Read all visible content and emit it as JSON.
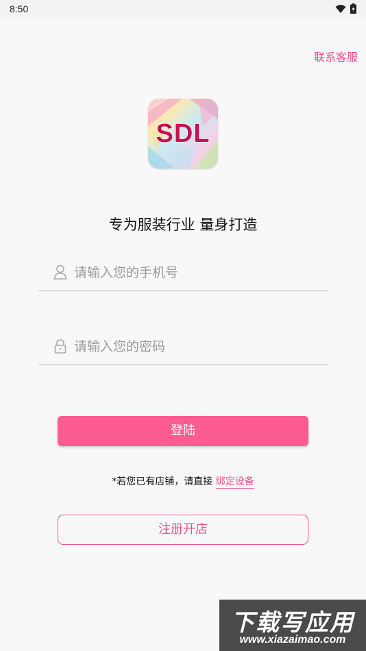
{
  "status_bar": {
    "time": "8:50",
    "icons": [
      "wifi-icon",
      "battery-icon"
    ]
  },
  "header": {
    "contact_label": "联系客服"
  },
  "logo": {
    "text": "SDL"
  },
  "slogan": "专为服装行业 量身打造",
  "form": {
    "phone": {
      "placeholder": "请输入您的手机号",
      "value": "",
      "icon": "user-icon"
    },
    "password": {
      "placeholder": "请输入您的密码",
      "value": "",
      "icon": "lock-icon"
    }
  },
  "login_label": "登陆",
  "bind": {
    "prefix": "*若您已有店铺，请直接 ",
    "link": "绑定设备"
  },
  "register_label": "注册开店",
  "watermark": {
    "title": "下载写应用",
    "url": "www.xiazaimao.com"
  },
  "colors": {
    "accent": "#fc5c8f",
    "link": "#f0508a",
    "background": "#f8f8f8"
  }
}
